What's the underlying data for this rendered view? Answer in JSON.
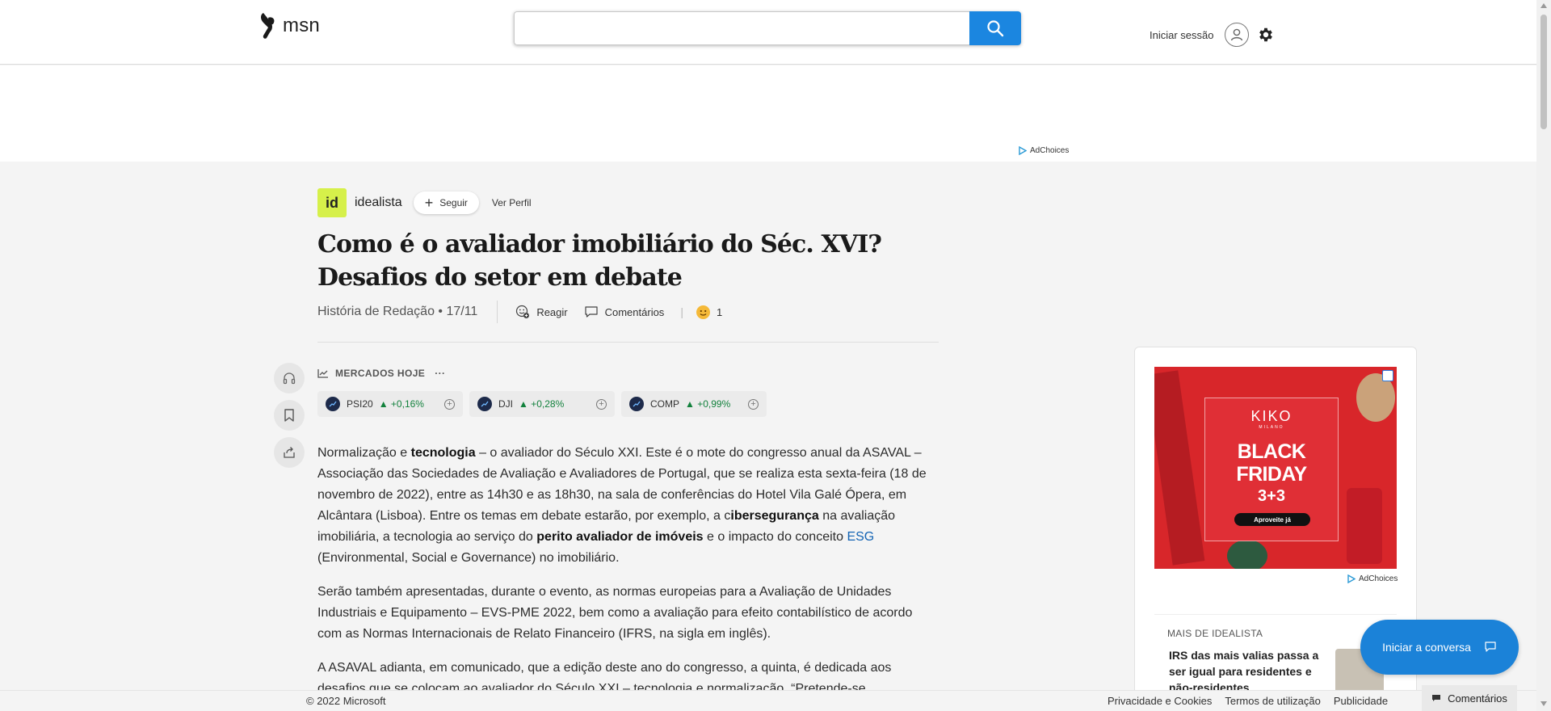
{
  "header": {
    "logo_text": "msn",
    "search_placeholder": "",
    "signin_label": "Iniciar sessão"
  },
  "ad": {
    "adchoices_label": "AdChoices"
  },
  "article": {
    "source_logo_text": "id",
    "source_name": "idealista",
    "follow_label": "Seguir",
    "profile_label": "Ver Perfil",
    "title": "Como é o avaliador imobiliário do Séc. XVI? Desafios do setor em debate",
    "byline": "História de Redação • 17/11",
    "react_label": "Reagir",
    "comments_label": "Comentários",
    "reaction_count": "1",
    "markets_title": "MERCADOS HOJE",
    "markets_more": "···",
    "tickers": [
      {
        "name": "PSI20",
        "change": "+0,16%"
      },
      {
        "name": "DJI",
        "change": "+0,28%"
      },
      {
        "name": "COMP",
        "change": "+0,99%"
      }
    ],
    "p1": {
      "a": "Normalização e ",
      "b": "tecnologia",
      "c": " – o avaliador do Século XXI. Este é o mote do congresso anual da ASAVAL – Associação das Sociedades de Avaliação e Avaliadores de Portugal, que se realiza esta sexta-feira (18 de novembro de 2022), entre as 14h30 e as 18h30, na sala de conferências do Hotel Vila Galé Ópera, em Alcântara (Lisboa). Entre os temas em debate estarão, por exemplo, a c",
      "d": "ibersegurança",
      "e": " na avaliação imobiliária, a tecnologia ao serviço do ",
      "f": "perito avaliador de imóveis",
      "g": " e o impacto do conceito ",
      "h": "ESG",
      "i": " (Environmental, Social e Governance) no imobiliário."
    },
    "p2": "Serão também apresentadas, durante o evento, as normas europeias para a Avaliação de Unidades Industriais e Equipamento – EVS-PME 2022, bem como a avaliação para efeito contabilístico de acordo com as Normas Internacionais de Relato Financeiro (IFRS, na sigla em inglês).",
    "p3": "A ASAVAL adianta, em comunicado, que a edição deste ano do congresso, a quinta, é dedicada aos desafios que se colocam ao avaliador do Século XXI – tecnologia e normalização. “Pretende-se"
  },
  "sidebar_ad": {
    "brand": "KIKO",
    "brand_sub": "MILANO",
    "headline": "BLACK FRIDAY",
    "offer": "3+3",
    "cta": "Aproveite já",
    "adchoices_label": "AdChoices"
  },
  "more_from": {
    "label": "MAIS DE IDEALISTA",
    "item": "IRS das mais valias passa a ser igual para residentes e não-residentes"
  },
  "chat": {
    "label": "Iniciar a conversa"
  },
  "footer": {
    "copyright": "© 2022 Microsoft",
    "links": [
      "Privacidade e Cookies",
      "Termos de utilização",
      "Publicidade"
    ],
    "comments_tab": "Comentários"
  },
  "colors": {
    "accent": "#1b86e0",
    "positive": "#12813c",
    "source_badge": "#d6f04a",
    "ad_red": "#d8262a"
  }
}
